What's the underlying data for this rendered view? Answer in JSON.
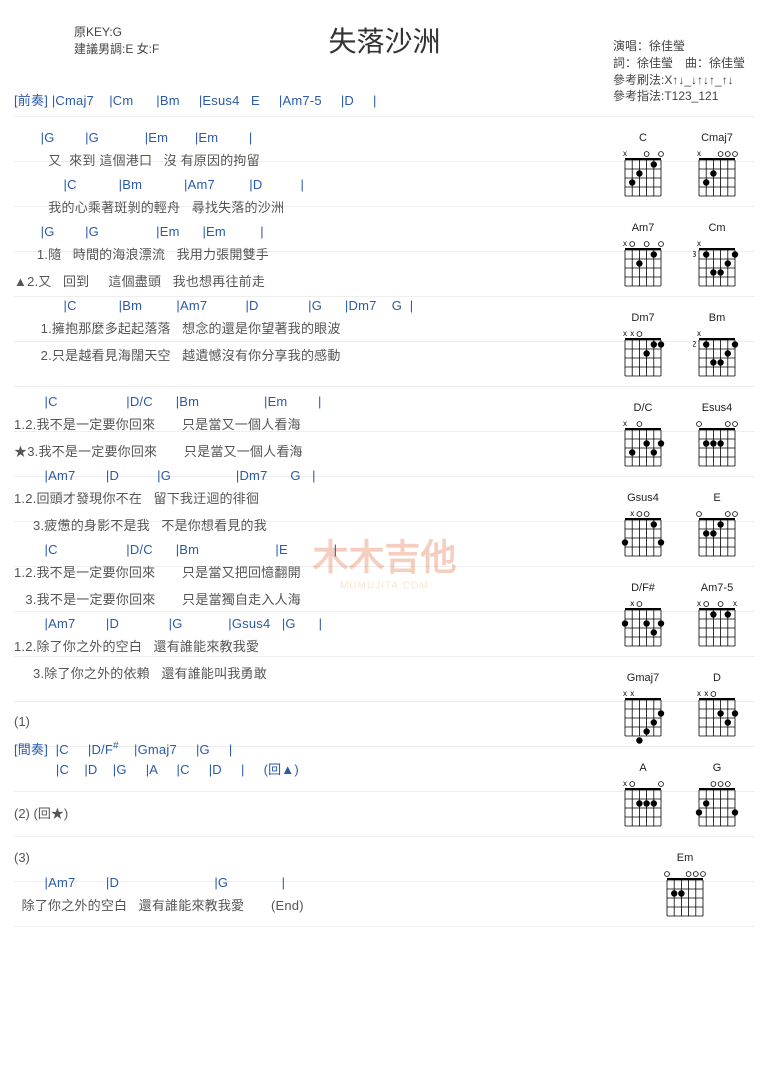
{
  "title": "失落沙洲",
  "meta_left": {
    "key": "原KEY:G",
    "suggest": "建議男調:E 女:F"
  },
  "meta_right": {
    "singer": "演唱：徐佳瑩",
    "credit": "詞：徐佳瑩　曲：徐佳瑩",
    "strum": "參考刷法:X↑↓_↓↑↓↑_↑↓",
    "finger": "參考指法:T123_121"
  },
  "intro": "[前奏] |Cmaj7    |Cm      |Bm     |Esus4   E     |Am7-5     |D     |",
  "lines": [
    {
      "c": "       |G        |G            |Em       |Em        |",
      "l": "         又  來到 這個港口   沒 有原因的拘留"
    },
    {
      "c": "             |C           |Bm           |Am7         |D          |",
      "l": "         我的心乘著斑剝的輕舟   尋找失落的沙洲"
    },
    {
      "c": "       |G        |G               |Em      |Em         |",
      "l": "      1.隨   時間的海浪漂流   我用力張開雙手"
    },
    {
      "c": "",
      "l": "▲2.又   回到     這個盡頭   我也想再往前走"
    },
    {
      "c": "             |C           |Bm         |Am7          |D             |G      |Dm7    G  |",
      "l": "       1.擁抱那麼多起起落落   想念的還是你望著我的眼波"
    },
    {
      "c": "",
      "l": "       2.只是越看見海闊天空   越遺憾沒有你分享我的感動"
    },
    {
      "c": "",
      "l": ""
    },
    {
      "c": "        |C                  |D/C      |Bm                 |Em        |",
      "l": "1.2.我不是一定要你回來       只是當又一個人看海"
    },
    {
      "c": "",
      "l": "★3.我不是一定要你回來       只是當又一個人看海"
    },
    {
      "c": "        |Am7        |D          |G                 |Dm7      G   |",
      "l": "1.2.回頭才發現你不在   留下我迂迴的徘徊"
    },
    {
      "c": "",
      "l": "     3.疲憊的身影不是我   不是你想看見的我"
    },
    {
      "c": "        |C                  |D/C      |Bm                    |E            |",
      "l": "1.2.我不是一定要你回來       只是當又把回憶翻開"
    },
    {
      "c": "",
      "l": "   3.我不是一定要你回來       只是當獨自走入人海"
    },
    {
      "c": "        |Am7        |D             |G            |Gsus4   |G      |",
      "l": "1.2.除了你之外的空白   還有誰能來教我愛"
    },
    {
      "c": "",
      "l": "     3.除了你之外的依賴   還有誰能叫我勇敢"
    }
  ],
  "outro": {
    "s1": "(1)",
    "inter1": "[間奏]  |C     |D/F#    |Gmaj7     |G     |",
    "inter2": "           |C    |D    |G     |A     |C     |D     |     (回▲)",
    "s2": "(2)  (回★)",
    "s3": "(3)",
    "endc": "        |Am7        |D                         |G              |",
    "endl": "  除了你之外的空白   還有誰能來教我愛       (End)"
  },
  "chord_diagrams": [
    {
      "row": [
        {
          "name": "C",
          "frets": [
            -1,
            3,
            2,
            0,
            1,
            0
          ],
          "base": 1
        },
        {
          "name": "Cmaj7",
          "frets": [
            -1,
            3,
            2,
            0,
            0,
            0
          ],
          "base": 1
        }
      ]
    },
    {
      "row": [
        {
          "name": "Am7",
          "frets": [
            -1,
            0,
            2,
            0,
            1,
            0
          ],
          "base": 1
        },
        {
          "name": "Cm",
          "frets": [
            -1,
            1,
            3,
            3,
            2,
            1
          ],
          "base": 3
        }
      ]
    },
    {
      "row": [
        {
          "name": "Dm7",
          "frets": [
            -1,
            -1,
            0,
            2,
            1,
            1
          ],
          "base": 1
        },
        {
          "name": "Bm",
          "frets": [
            -1,
            1,
            3,
            3,
            2,
            1
          ],
          "base": 2
        }
      ]
    },
    {
      "row": [
        {
          "name": "D/C",
          "frets": [
            -1,
            3,
            0,
            2,
            3,
            2
          ],
          "base": 1
        },
        {
          "name": "Esus4",
          "frets": [
            0,
            2,
            2,
            2,
            0,
            0
          ],
          "base": 1
        }
      ]
    },
    {
      "row": [
        {
          "name": "Gsus4",
          "frets": [
            3,
            -1,
            0,
            0,
            1,
            3
          ],
          "base": 1
        },
        {
          "name": "E",
          "frets": [
            0,
            2,
            2,
            1,
            0,
            0
          ],
          "base": 1
        }
      ]
    },
    {
      "row": [
        {
          "name": "D/F#",
          "frets": [
            2,
            -1,
            0,
            2,
            3,
            2
          ],
          "base": 1
        },
        {
          "name": "Am7-5",
          "frets": [
            -1,
            0,
            1,
            0,
            1,
            -1
          ],
          "base": 1
        }
      ]
    },
    {
      "row": [
        {
          "name": "Gmaj7",
          "frets": [
            -1,
            -1,
            5,
            4,
            3,
            2
          ],
          "base": 1
        },
        {
          "name": "D",
          "frets": [
            -1,
            -1,
            0,
            2,
            3,
            2
          ],
          "base": 1
        }
      ]
    },
    {
      "row": [
        {
          "name": "A",
          "frets": [
            -1,
            0,
            2,
            2,
            2,
            0
          ],
          "base": 1
        },
        {
          "name": "G",
          "frets": [
            3,
            2,
            0,
            0,
            0,
            3
          ],
          "base": 1
        }
      ]
    },
    {
      "single": {
        "name": "Em",
        "frets": [
          0,
          2,
          2,
          0,
          0,
          0
        ],
        "base": 1
      }
    }
  ],
  "watermark": {
    "line1": "木木吉他",
    "line2": "MUMUJITA.COM"
  }
}
